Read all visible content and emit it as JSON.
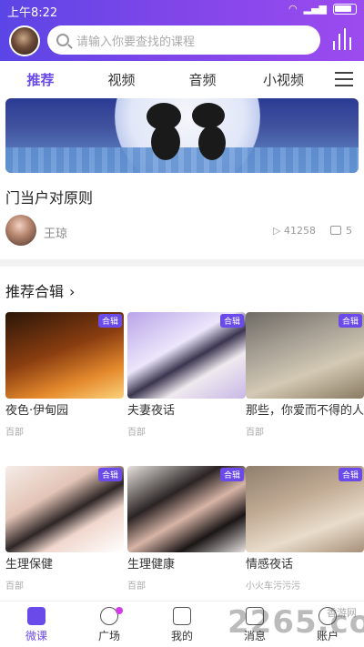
{
  "status_bar": {
    "time": "上午8:22",
    "battery": "Battery"
  },
  "header": {
    "search_placeholder": "请输入你要查找的课程"
  },
  "tabs": [
    {
      "label": "推荐"
    },
    {
      "label": "视频"
    },
    {
      "label": "音频"
    },
    {
      "label": "小视频"
    }
  ],
  "featured": {
    "title": "门当户对原则",
    "author": "王琼",
    "views": "41258",
    "comments": "5"
  },
  "section": {
    "title": "推荐合辑"
  },
  "cards": [
    {
      "badge": "合辑",
      "title": "夜色·伊甸园",
      "sub": "百部"
    },
    {
      "badge": "合辑",
      "title": "夫妻夜话",
      "sub": "百部"
    },
    {
      "badge": "合辑",
      "title": "那些，你爱而不得的人",
      "sub": "百部"
    },
    {
      "badge": "合辑",
      "title": "生理保健",
      "sub": "百部"
    },
    {
      "badge": "合辑",
      "title": "生理健康",
      "sub": "百部"
    },
    {
      "badge": "合辑",
      "title": "情感夜话",
      "sub": "小火车污污污"
    }
  ],
  "bottom_nav": [
    {
      "label": "微课"
    },
    {
      "label": "广场"
    },
    {
      "label": "我的"
    },
    {
      "label": "消息"
    },
    {
      "label": "账户"
    }
  ],
  "watermark": {
    "text": "2265.com",
    "site": "香游网"
  },
  "colors": {
    "accent": "#6a4ae8",
    "header_left": "#5b45e6",
    "header_right": "#9c4bef"
  }
}
